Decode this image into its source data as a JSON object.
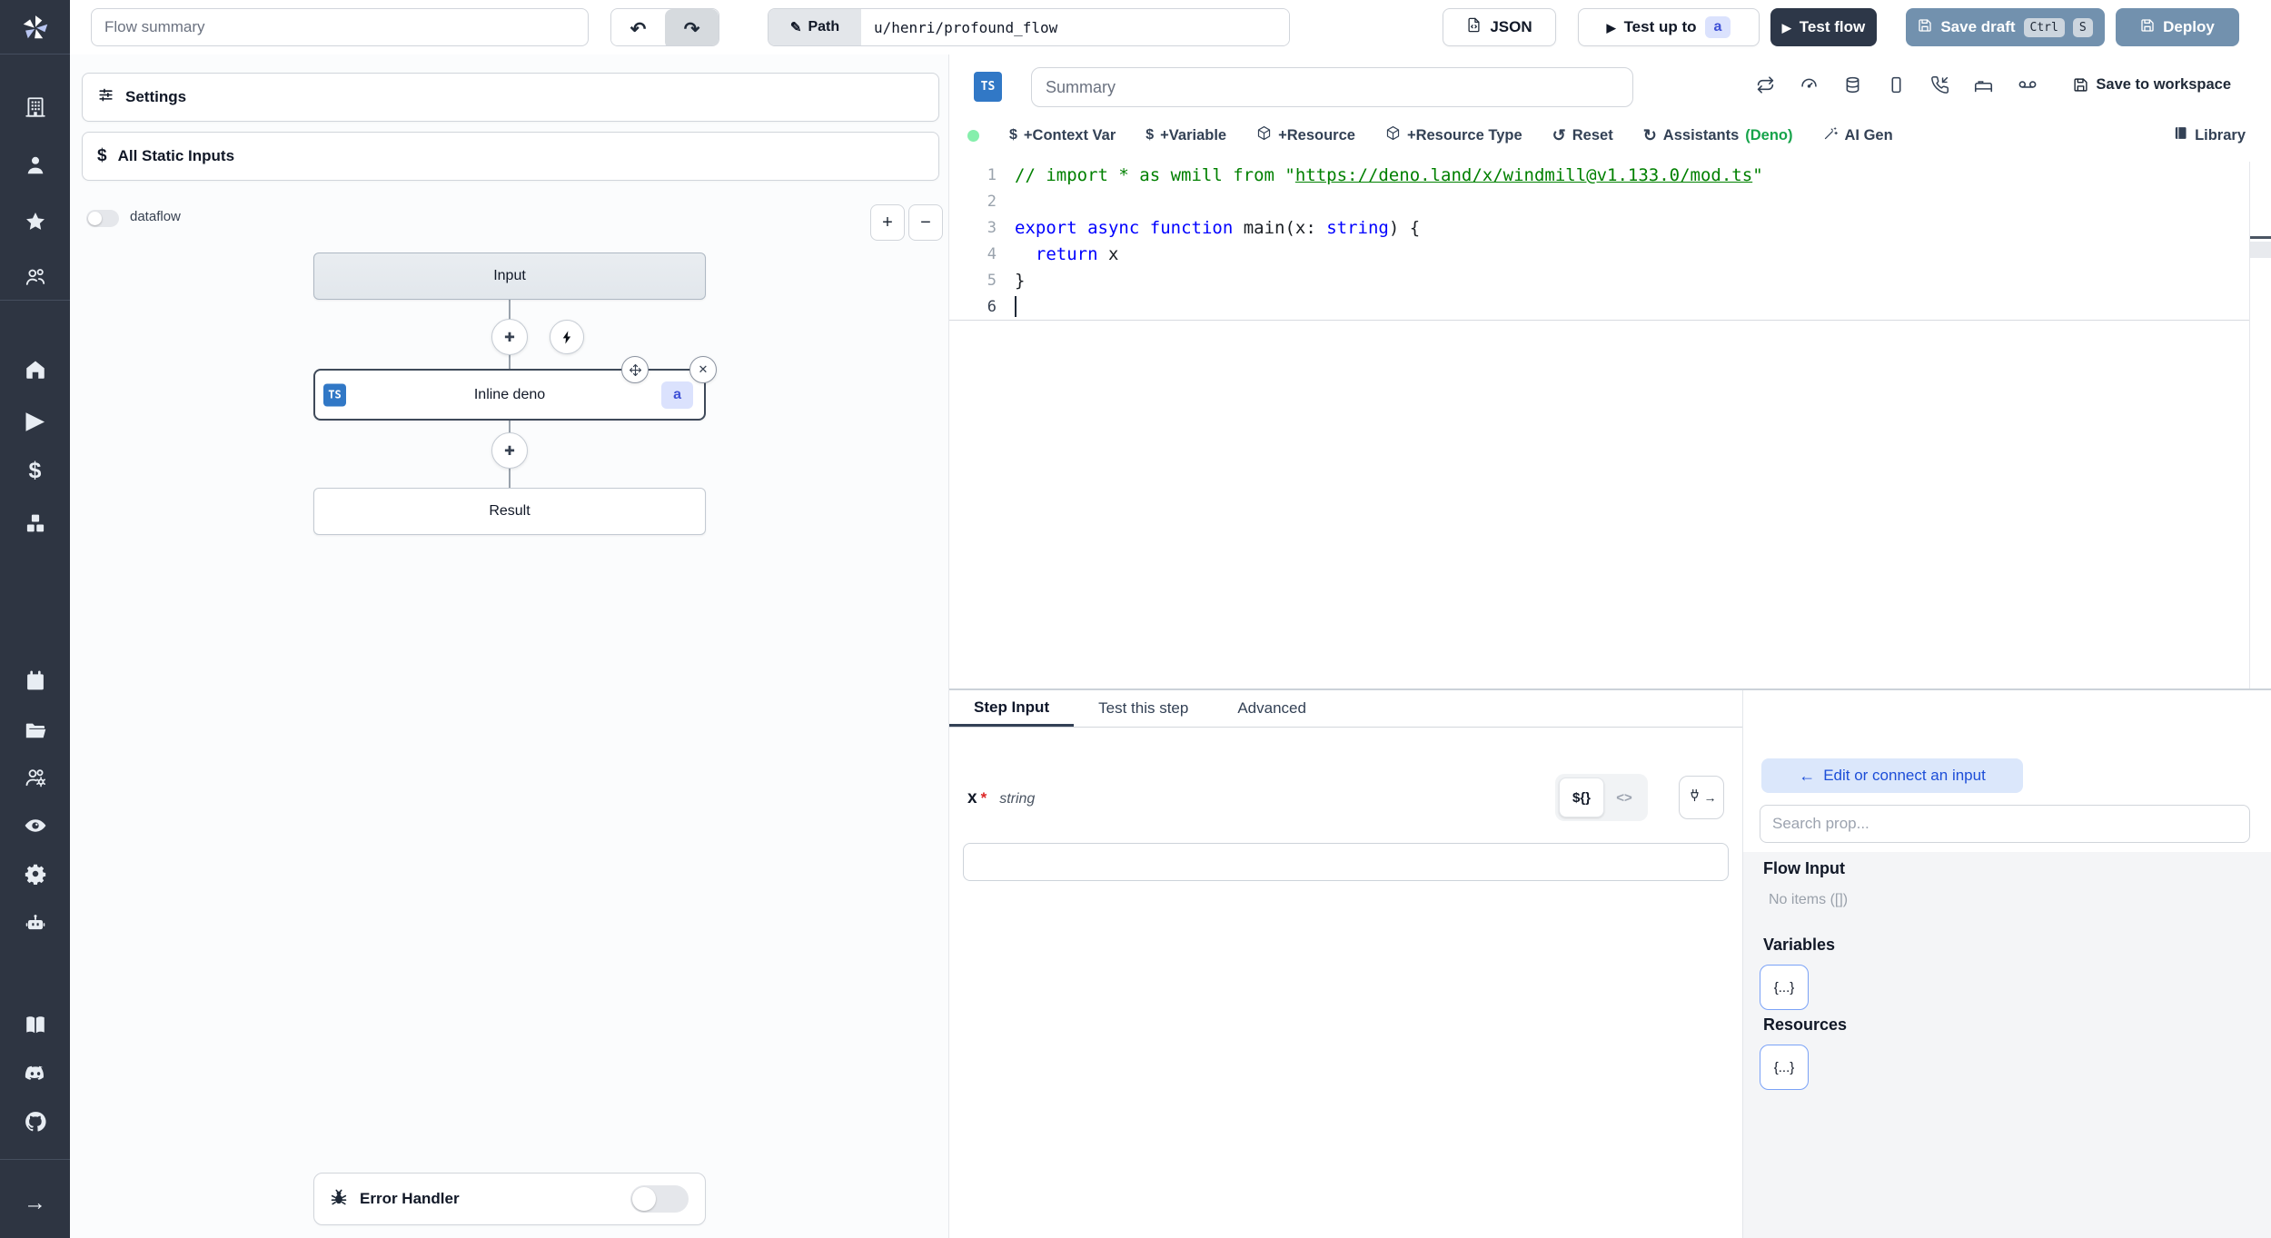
{
  "topbar": {
    "flow_summary_placeholder": "Flow summary",
    "path_label": "Path",
    "path_value": "u/henri/profound_flow",
    "json_label": "JSON",
    "test_up_to_label": "Test up to",
    "test_up_to_badge": "a",
    "test_flow_label": "Test flow",
    "save_draft_label": "Save draft",
    "kbd_ctrl": "Ctrl",
    "kbd_s": "S",
    "deploy_label": "Deploy"
  },
  "icons": {
    "undo": "↶",
    "redo": "↷",
    "pencil": "✎",
    "play": "▶",
    "plus": "✚",
    "minus": "−",
    "close": "✕",
    "back_arrow": "←",
    "dollar": "$",
    "reset_arrow": "↺",
    "assistants_arrow": "↻",
    "plug_arrow": "→"
  },
  "sidebar": {
    "icons": [
      "building",
      "user",
      "star",
      "user-group",
      "home",
      "play",
      "dollar",
      "boxes",
      "calendar",
      "folder-open",
      "users-cog",
      "eye",
      "settings",
      "bot",
      "book",
      "discord",
      "github",
      "arrow-right"
    ]
  },
  "flow": {
    "settings_label": "Settings",
    "static_inputs_label": "All Static Inputs",
    "dataflow_label": "dataflow",
    "nodes": {
      "input": "Input",
      "step": "Inline deno",
      "step_lang": "TS",
      "step_badge": "a",
      "result": "Result"
    },
    "error_handler_label": "Error Handler"
  },
  "editor": {
    "lang_badge": "TS",
    "summary_placeholder": "Summary",
    "save_to_workspace": "Save to workspace",
    "actions": {
      "context_var": "+Context Var",
      "variable": "+Variable",
      "resource": "+Resource",
      "resource_type": "+Resource Type",
      "reset": "Reset",
      "assistants": "Assistants",
      "assistants_mode": "(Deno)",
      "ai_gen": "AI Gen",
      "library": "Library"
    },
    "code": {
      "lines": [
        {
          "num": "1",
          "tokens": [
            {
              "c": "comment",
              "t": "// import * as wmill from \""
            },
            {
              "c": "link",
              "t": "https://deno.land/x/windmill@v1.133.0/mod.ts"
            },
            {
              "c": "comment",
              "t": "\""
            }
          ]
        },
        {
          "num": "2",
          "tokens": []
        },
        {
          "num": "3",
          "tokens": [
            {
              "c": "kw",
              "t": "export"
            },
            {
              "c": "plain",
              "t": " "
            },
            {
              "c": "kw",
              "t": "async"
            },
            {
              "c": "plain",
              "t": " "
            },
            {
              "c": "kw",
              "t": "function"
            },
            {
              "c": "plain",
              "t": " main(x: "
            },
            {
              "c": "kw",
              "t": "string"
            },
            {
              "c": "plain",
              "t": ") {"
            }
          ]
        },
        {
          "num": "4",
          "tokens": [
            {
              "c": "plain",
              "t": "  "
            },
            {
              "c": "kw",
              "t": "return"
            },
            {
              "c": "plain",
              "t": " x"
            }
          ]
        },
        {
          "num": "5",
          "tokens": [
            {
              "c": "plain",
              "t": "}"
            }
          ]
        },
        {
          "num": "6",
          "tokens": [],
          "cursor": true
        }
      ]
    }
  },
  "step": {
    "tabs": [
      "Step Input",
      "Test this step",
      "Advanced"
    ],
    "active_tab": "Step Input",
    "field": {
      "name": "x",
      "required": "*",
      "type": "string",
      "value": ""
    },
    "expr_toggle": "${}",
    "code_toggle": "<>"
  },
  "connect": {
    "edit_button": "Edit or connect an input",
    "search_placeholder": "Search prop...",
    "flow_input_title": "Flow Input",
    "flow_input_empty": "No items ([])",
    "variables_title": "Variables",
    "variables_chip": "{...}",
    "resources_title": "Resources",
    "resources_chip": "{...}"
  },
  "colors": {
    "sidebar_bg": "#2e3542",
    "accent_ts_blue": "#3178c6",
    "steel_blue": "#7291ae",
    "dark_navy": "#2d3748",
    "badge_indigo_bg": "#dbe2fd",
    "badge_indigo_text": "#3f51d6",
    "deno_green": "#16a34a",
    "comment_green": "#008000",
    "keyword_blue": "#0000ff",
    "edit_btn_blue": "#1d4ed8"
  }
}
